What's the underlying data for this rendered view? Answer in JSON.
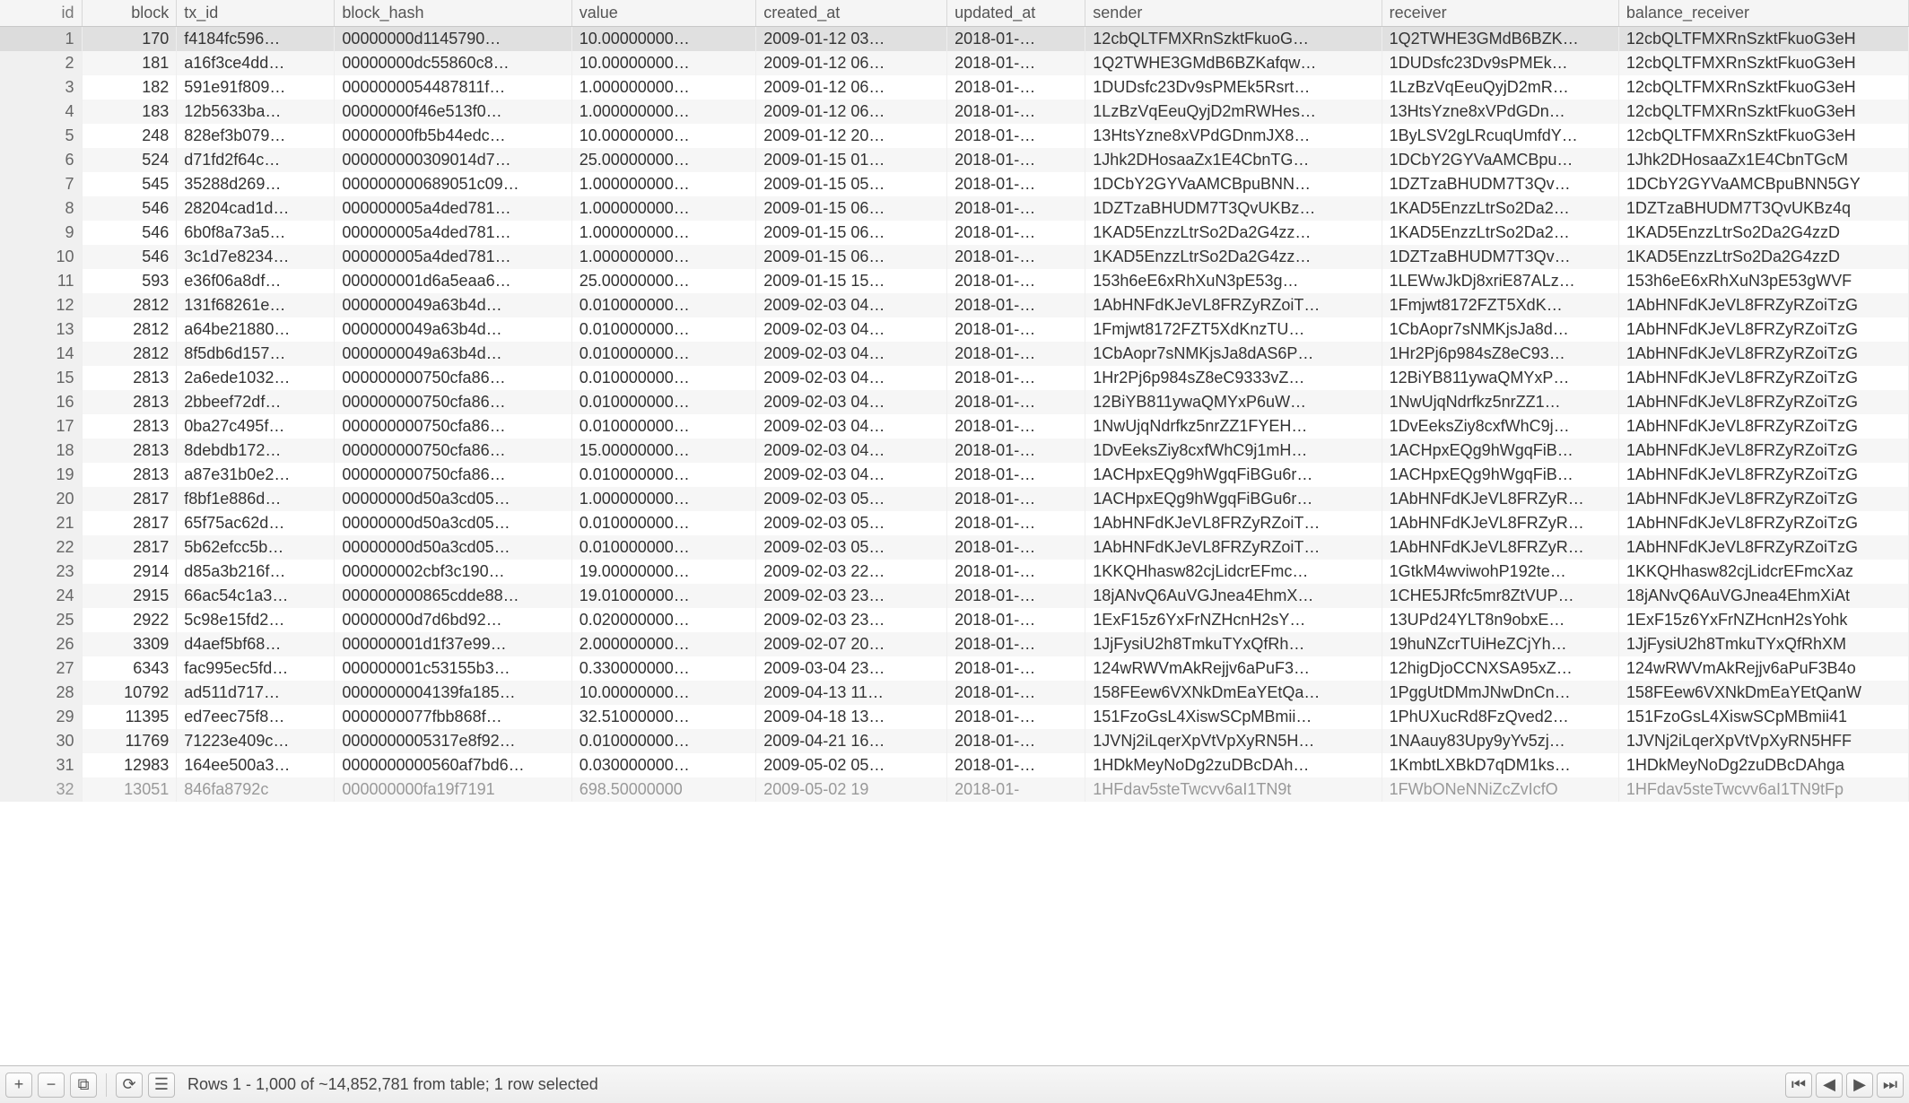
{
  "columns": [
    {
      "key": "id",
      "label": "id",
      "cls": "col-id"
    },
    {
      "key": "block",
      "label": "block",
      "cls": "col-block"
    },
    {
      "key": "tx_id",
      "label": "tx_id",
      "cls": "col-tx"
    },
    {
      "key": "block_hash",
      "label": "block_hash",
      "cls": "col-hash"
    },
    {
      "key": "value",
      "label": "value",
      "cls": "col-val"
    },
    {
      "key": "created_at",
      "label": "created_at",
      "cls": "col-ca"
    },
    {
      "key": "updated_at",
      "label": "updated_at",
      "cls": "col-ua"
    },
    {
      "key": "sender",
      "label": "sender",
      "cls": "col-send"
    },
    {
      "key": "receiver",
      "label": "receiver",
      "cls": "col-recv"
    },
    {
      "key": "balance_receiver",
      "label": "balance_receiver",
      "cls": "col-bal"
    }
  ],
  "rows": [
    {
      "id": 1,
      "block": 170,
      "tx_id": "f4184fc596…",
      "block_hash": "00000000d1145790…",
      "value": "10.00000000…",
      "created_at": "2009-01-12 03…",
      "updated_at": "2018-01-…",
      "sender": "12cbQLTFMXRnSzktFkuoG…",
      "receiver": "1Q2TWHE3GMdB6BZK…",
      "balance_receiver": "12cbQLTFMXRnSzktFkuoG3eH",
      "selected": true
    },
    {
      "id": 2,
      "block": 181,
      "tx_id": "a16f3ce4dd…",
      "block_hash": "00000000dc55860c8…",
      "value": "10.00000000…",
      "created_at": "2009-01-12 06…",
      "updated_at": "2018-01-…",
      "sender": "1Q2TWHE3GMdB6BZKafqw…",
      "receiver": "1DUDsfc23Dv9sPMEk…",
      "balance_receiver": "12cbQLTFMXRnSzktFkuoG3eH"
    },
    {
      "id": 3,
      "block": 182,
      "tx_id": "591e91f809…",
      "block_hash": "0000000054487811f…",
      "value": "1.000000000…",
      "created_at": "2009-01-12 06…",
      "updated_at": "2018-01-…",
      "sender": "1DUDsfc23Dv9sPMEk5Rsrt…",
      "receiver": "1LzBzVqEeuQyjD2mR…",
      "balance_receiver": "12cbQLTFMXRnSzktFkuoG3eH"
    },
    {
      "id": 4,
      "block": 183,
      "tx_id": "12b5633ba…",
      "block_hash": "00000000f46e513f0…",
      "value": "1.000000000…",
      "created_at": "2009-01-12 06…",
      "updated_at": "2018-01-…",
      "sender": "1LzBzVqEeuQyjD2mRWHes…",
      "receiver": "13HtsYzne8xVPdGDn…",
      "balance_receiver": "12cbQLTFMXRnSzktFkuoG3eH"
    },
    {
      "id": 5,
      "block": 248,
      "tx_id": "828ef3b079…",
      "block_hash": "00000000fb5b44edc…",
      "value": "10.00000000…",
      "created_at": "2009-01-12 20…",
      "updated_at": "2018-01-…",
      "sender": "13HtsYzne8xVPdGDnmJX8…",
      "receiver": "1ByLSV2gLRcuqUmfdY…",
      "balance_receiver": "12cbQLTFMXRnSzktFkuoG3eH"
    },
    {
      "id": 6,
      "block": 524,
      "tx_id": "d71fd2f64c…",
      "block_hash": "000000000309014d7…",
      "value": "25.00000000…",
      "created_at": "2009-01-15 01…",
      "updated_at": "2018-01-…",
      "sender": "1Jhk2DHosaaZx1E4CbnTG…",
      "receiver": "1DCbY2GYVaAMCBpu…",
      "balance_receiver": "1Jhk2DHosaaZx1E4CbnTGcM"
    },
    {
      "id": 7,
      "block": 545,
      "tx_id": "35288d269…",
      "block_hash": "000000000689051c09…",
      "value": "1.000000000…",
      "created_at": "2009-01-15 05…",
      "updated_at": "2018-01-…",
      "sender": "1DCbY2GYVaAMCBpuBNN…",
      "receiver": "1DZTzaBHUDM7T3Qv…",
      "balance_receiver": "1DCbY2GYVaAMCBpuBNN5GY"
    },
    {
      "id": 8,
      "block": 546,
      "tx_id": "28204cad1d…",
      "block_hash": "000000005a4ded781…",
      "value": "1.000000000…",
      "created_at": "2009-01-15 06…",
      "updated_at": "2018-01-…",
      "sender": "1DZTzaBHUDM7T3QvUKBz…",
      "receiver": "1KAD5EnzzLtrSo2Da2…",
      "balance_receiver": "1DZTzaBHUDM7T3QvUKBz4q"
    },
    {
      "id": 9,
      "block": 546,
      "tx_id": "6b0f8a73a5…",
      "block_hash": "000000005a4ded781…",
      "value": "1.000000000…",
      "created_at": "2009-01-15 06…",
      "updated_at": "2018-01-…",
      "sender": "1KAD5EnzzLtrSo2Da2G4zz…",
      "receiver": "1KAD5EnzzLtrSo2Da2…",
      "balance_receiver": "1KAD5EnzzLtrSo2Da2G4zzD"
    },
    {
      "id": 10,
      "block": 546,
      "tx_id": "3c1d7e8234…",
      "block_hash": "000000005a4ded781…",
      "value": "1.000000000…",
      "created_at": "2009-01-15 06…",
      "updated_at": "2018-01-…",
      "sender": "1KAD5EnzzLtrSo2Da2G4zz…",
      "receiver": "1DZTzaBHUDM7T3Qv…",
      "balance_receiver": "1KAD5EnzzLtrSo2Da2G4zzD"
    },
    {
      "id": 11,
      "block": 593,
      "tx_id": "e36f06a8df…",
      "block_hash": "000000001d6a5eaa6…",
      "value": "25.00000000…",
      "created_at": "2009-01-15 15…",
      "updated_at": "2018-01-…",
      "sender": "153h6eE6xRhXuN3pE53g…",
      "receiver": "1LEWwJkDj8xriE87ALz…",
      "balance_receiver": "153h6eE6xRhXuN3pE53gWVF"
    },
    {
      "id": 12,
      "block": 2812,
      "tx_id": "131f68261e…",
      "block_hash": "0000000049a63b4d…",
      "value": "0.010000000…",
      "created_at": "2009-02-03 04…",
      "updated_at": "2018-01-…",
      "sender": "1AbHNFdKJeVL8FRZyRZoiT…",
      "receiver": "1Fmjwt8172FZT5XdK…",
      "balance_receiver": "1AbHNFdKJeVL8FRZyRZoiTzG"
    },
    {
      "id": 13,
      "block": 2812,
      "tx_id": "a64be21880…",
      "block_hash": "0000000049a63b4d…",
      "value": "0.010000000…",
      "created_at": "2009-02-03 04…",
      "updated_at": "2018-01-…",
      "sender": "1Fmjwt8172FZT5XdKnzTU…",
      "receiver": "1CbAopr7sNMKjsJa8d…",
      "balance_receiver": "1AbHNFdKJeVL8FRZyRZoiTzG"
    },
    {
      "id": 14,
      "block": 2812,
      "tx_id": "8f5db6d157…",
      "block_hash": "0000000049a63b4d…",
      "value": "0.010000000…",
      "created_at": "2009-02-03 04…",
      "updated_at": "2018-01-…",
      "sender": "1CbAopr7sNMKjsJa8dAS6P…",
      "receiver": "1Hr2Pj6p984sZ8eC93…",
      "balance_receiver": "1AbHNFdKJeVL8FRZyRZoiTzG"
    },
    {
      "id": 15,
      "block": 2813,
      "tx_id": "2a6ede1032…",
      "block_hash": "000000000750cfa86…",
      "value": "0.010000000…",
      "created_at": "2009-02-03 04…",
      "updated_at": "2018-01-…",
      "sender": "1Hr2Pj6p984sZ8eC9333vZ…",
      "receiver": "12BiYB811ywaQMYxP…",
      "balance_receiver": "1AbHNFdKJeVL8FRZyRZoiTzG"
    },
    {
      "id": 16,
      "block": 2813,
      "tx_id": "2bbeef72df…",
      "block_hash": "000000000750cfa86…",
      "value": "0.010000000…",
      "created_at": "2009-02-03 04…",
      "updated_at": "2018-01-…",
      "sender": "12BiYB811ywaQMYxP6uW…",
      "receiver": "1NwUjqNdrfkz5nrZZ1…",
      "balance_receiver": "1AbHNFdKJeVL8FRZyRZoiTzG"
    },
    {
      "id": 17,
      "block": 2813,
      "tx_id": "0ba27c495f…",
      "block_hash": "000000000750cfa86…",
      "value": "0.010000000…",
      "created_at": "2009-02-03 04…",
      "updated_at": "2018-01-…",
      "sender": "1NwUjqNdrfkz5nrZZ1FYEH…",
      "receiver": "1DvEeksZiy8cxfWhC9j…",
      "balance_receiver": "1AbHNFdKJeVL8FRZyRZoiTzG"
    },
    {
      "id": 18,
      "block": 2813,
      "tx_id": "8debdb172…",
      "block_hash": "000000000750cfa86…",
      "value": "15.00000000…",
      "created_at": "2009-02-03 04…",
      "updated_at": "2018-01-…",
      "sender": "1DvEeksZiy8cxfWhC9j1mH…",
      "receiver": "1ACHpxEQg9hWgqFiB…",
      "balance_receiver": "1AbHNFdKJeVL8FRZyRZoiTzG"
    },
    {
      "id": 19,
      "block": 2813,
      "tx_id": "a87e31b0e2…",
      "block_hash": "000000000750cfa86…",
      "value": "0.010000000…",
      "created_at": "2009-02-03 04…",
      "updated_at": "2018-01-…",
      "sender": "1ACHpxEQg9hWgqFiBGu6r…",
      "receiver": "1ACHpxEQg9hWgqFiB…",
      "balance_receiver": "1AbHNFdKJeVL8FRZyRZoiTzG"
    },
    {
      "id": 20,
      "block": 2817,
      "tx_id": "f8bf1e886d…",
      "block_hash": "00000000d50a3cd05…",
      "value": "1.000000000…",
      "created_at": "2009-02-03 05…",
      "updated_at": "2018-01-…",
      "sender": "1ACHpxEQg9hWgqFiBGu6r…",
      "receiver": "1AbHNFdKJeVL8FRZyR…",
      "balance_receiver": "1AbHNFdKJeVL8FRZyRZoiTzG"
    },
    {
      "id": 21,
      "block": 2817,
      "tx_id": "65f75ac62d…",
      "block_hash": "00000000d50a3cd05…",
      "value": "0.010000000…",
      "created_at": "2009-02-03 05…",
      "updated_at": "2018-01-…",
      "sender": "1AbHNFdKJeVL8FRZyRZoiT…",
      "receiver": "1AbHNFdKJeVL8FRZyR…",
      "balance_receiver": "1AbHNFdKJeVL8FRZyRZoiTzG"
    },
    {
      "id": 22,
      "block": 2817,
      "tx_id": "5b62efcc5b…",
      "block_hash": "00000000d50a3cd05…",
      "value": "0.010000000…",
      "created_at": "2009-02-03 05…",
      "updated_at": "2018-01-…",
      "sender": "1AbHNFdKJeVL8FRZyRZoiT…",
      "receiver": "1AbHNFdKJeVL8FRZyR…",
      "balance_receiver": "1AbHNFdKJeVL8FRZyRZoiTzG"
    },
    {
      "id": 23,
      "block": 2914,
      "tx_id": "d85a3b216f…",
      "block_hash": "000000002cbf3c190…",
      "value": "19.00000000…",
      "created_at": "2009-02-03 22…",
      "updated_at": "2018-01-…",
      "sender": "1KKQHhasw82cjLidcrEFmc…",
      "receiver": "1GtkM4wviwohP192te…",
      "balance_receiver": "1KKQHhasw82cjLidcrEFmcXaz"
    },
    {
      "id": 24,
      "block": 2915,
      "tx_id": "66ac54c1a3…",
      "block_hash": "000000000865cdde88…",
      "value": "19.01000000…",
      "created_at": "2009-02-03 23…",
      "updated_at": "2018-01-…",
      "sender": "18jANvQ6AuVGJnea4EhmX…",
      "receiver": "1CHE5JRfc5mr8ZtVUP…",
      "balance_receiver": "18jANvQ6AuVGJnea4EhmXiAt"
    },
    {
      "id": 25,
      "block": 2922,
      "tx_id": "5c98e15fd2…",
      "block_hash": "00000000d7d6bd92…",
      "value": "0.020000000…",
      "created_at": "2009-02-03 23…",
      "updated_at": "2018-01-…",
      "sender": "1ExF15z6YxFrNZHcnH2sY…",
      "receiver": "13UPd24YLT8n9obxE…",
      "balance_receiver": "1ExF15z6YxFrNZHcnH2sYohk"
    },
    {
      "id": 26,
      "block": 3309,
      "tx_id": "d4aef5bf68…",
      "block_hash": "000000001d1f37e99…",
      "value": "2.000000000…",
      "created_at": "2009-02-07 20…",
      "updated_at": "2018-01-…",
      "sender": "1JjFysiU2h8TmkuTYxQfRh…",
      "receiver": "19huNZcrTUiHeZCjYh…",
      "balance_receiver": "1JjFysiU2h8TmkuTYxQfRhXM"
    },
    {
      "id": 27,
      "block": 6343,
      "tx_id": "fac995ec5fd…",
      "block_hash": "000000001c53155b3…",
      "value": "0.330000000…",
      "created_at": "2009-03-04 23…",
      "updated_at": "2018-01-…",
      "sender": "124wRWVmAkRejjv6aPuF3…",
      "receiver": "12higDjoCCNXSA95xZ…",
      "balance_receiver": "124wRWVmAkRejjv6aPuF3B4o"
    },
    {
      "id": 28,
      "block": 10792,
      "tx_id": "ad511d717…",
      "block_hash": "0000000004139fa185…",
      "value": "10.00000000…",
      "created_at": "2009-04-13 11…",
      "updated_at": "2018-01-…",
      "sender": "158FEew6VXNkDmEaYEtQa…",
      "receiver": "1PggUtDMmJNwDnCn…",
      "balance_receiver": "158FEew6VXNkDmEaYEtQanW"
    },
    {
      "id": 29,
      "block": 11395,
      "tx_id": "ed7eec75f8…",
      "block_hash": "0000000077fbb868f…",
      "value": "32.51000000…",
      "created_at": "2009-04-18 13…",
      "updated_at": "2018-01-…",
      "sender": "151FzoGsL4XiswSCpMBmii…",
      "receiver": "1PhUXucRd8FzQved2…",
      "balance_receiver": "151FzoGsL4XiswSCpMBmii41"
    },
    {
      "id": 30,
      "block": 11769,
      "tx_id": "71223e409c…",
      "block_hash": "0000000005317e8f92…",
      "value": "0.010000000…",
      "created_at": "2009-04-21 16…",
      "updated_at": "2018-01-…",
      "sender": "1JVNj2iLqerXpVtVpXyRN5H…",
      "receiver": "1NAauy83Upy9yYv5zj…",
      "balance_receiver": "1JVNj2iLqerXpVtVpXyRN5HFF"
    },
    {
      "id": 31,
      "block": 12983,
      "tx_id": "164ee500a3…",
      "block_hash": "0000000000560af7bd6…",
      "value": "0.030000000…",
      "created_at": "2009-05-02 05…",
      "updated_at": "2018-01-…",
      "sender": "1HDkMeyNoDg2zuDBcDAh…",
      "receiver": "1KmbtLXBkD7qDM1ks…",
      "balance_receiver": "1HDkMeyNoDg2zuDBcDAhga"
    },
    {
      "id": 32,
      "block": 13051,
      "tx_id": "846fa8792c",
      "block_hash": "000000000fa19f7191",
      "value": "698.50000000",
      "created_at": "2009-05-02 19",
      "updated_at": "2018-01-",
      "sender": "1HFdav5steTwcvv6aI1TN9t",
      "receiver": "1FWbONeNNiZcZvIcfO",
      "balance_receiver": "1HFdav5steTwcvv6aI1TN9tFp",
      "faded": true
    }
  ],
  "footer": {
    "status": "Rows 1 - 1,000 of ~14,852,781 from table; 1 row selected"
  }
}
